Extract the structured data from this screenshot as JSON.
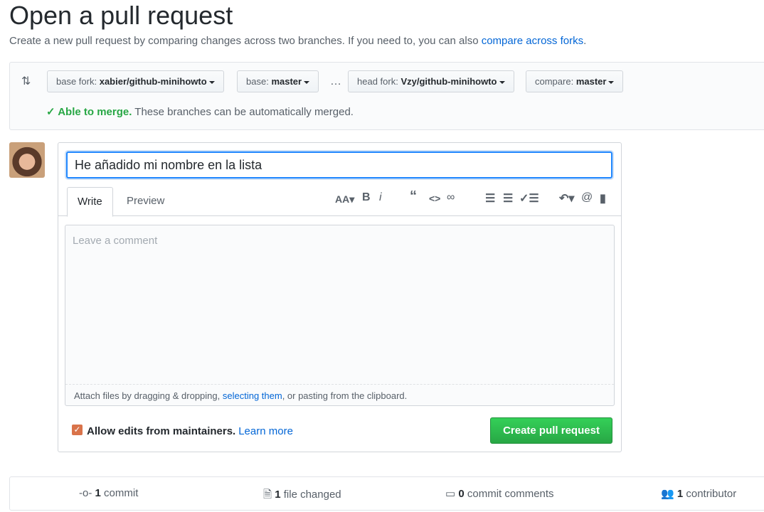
{
  "page": {
    "title": "Open a pull request",
    "subtitle": "Create a new pull request by comparing changes across two branches. If you need to, you can also ",
    "subtitle_link": "compare across forks",
    "subtitle_end": "."
  },
  "compare": {
    "base_fork_label": "base fork:",
    "base_fork": "xabier/github-minihowto",
    "base_label": "base:",
    "base": "master",
    "ellipsis": "…",
    "head_fork_label": "head fork:",
    "head_fork": "Vzy/github-minihowto",
    "compare_label": "compare:",
    "compare": "master",
    "merge_status": "Able to merge.",
    "merge_text": "These branches can be automatically merged."
  },
  "form": {
    "title_value": "He añadido mi nombre en la lista",
    "tabs": [
      "Write",
      "Preview"
    ],
    "toolbar": [
      "text-size-icon",
      "bold-icon",
      "italic-icon",
      "quote-icon",
      "code-icon",
      "link-icon",
      "bulleted-list-icon",
      "numbered-list-icon",
      "task-list-icon",
      "reply-icon",
      "mention-icon",
      "bookmark-icon"
    ],
    "comment_placeholder": "Leave a comment",
    "attach_pre": "Attach files by dragging & dropping, ",
    "attach_link": "selecting them",
    "attach_post": ", or pasting from the clipboard.",
    "allow_edits": "Allow edits from maintainers.",
    "learn_more": "Learn more",
    "allow_checked": true,
    "submit": "Create pull request"
  },
  "stats": {
    "commits": "1",
    "commits_label": "commit",
    "files": "1",
    "files_label": "file changed",
    "comments": "0",
    "comments_label": "commit comments",
    "contributors": "1",
    "contributors_label": "contributor"
  },
  "colors": {
    "accent": "#0366d6",
    "success": "#28a745"
  }
}
